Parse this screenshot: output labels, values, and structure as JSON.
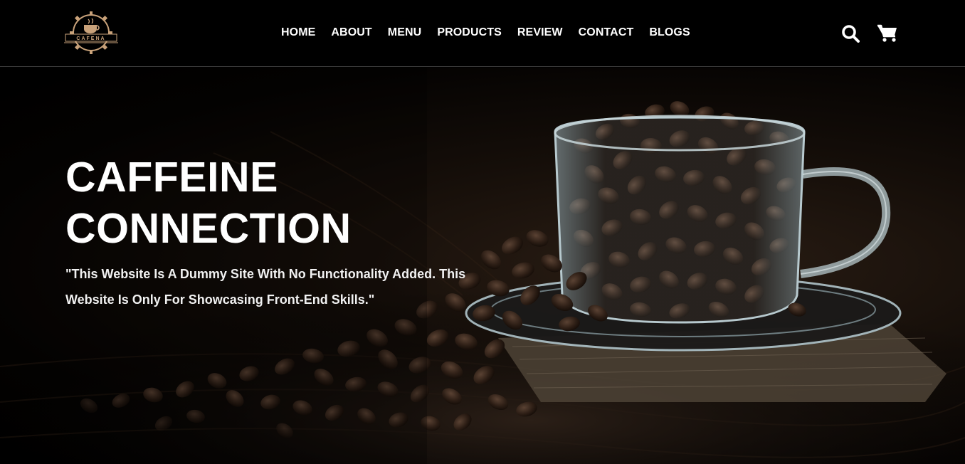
{
  "brand": {
    "logo_text": "CAFENA",
    "logo_color": "#c9a27a"
  },
  "nav": {
    "items": [
      {
        "label": "HOME"
      },
      {
        "label": "ABOUT"
      },
      {
        "label": "MENU"
      },
      {
        "label": "PRODUCTS"
      },
      {
        "label": "REVIEW"
      },
      {
        "label": "CONTACT"
      },
      {
        "label": "BLOGS"
      }
    ]
  },
  "header_icons": {
    "search": "search-icon",
    "cart": "cart-icon"
  },
  "hero": {
    "title_line1": "CAFFEINE",
    "title_line2": "CONNECTION",
    "description": "\"This Website Is A Dummy Site With No Functionality Added. This Website Is Only For Showcasing Front-End Skills.\""
  },
  "colors": {
    "background": "#000000",
    "text": "#ffffff",
    "accent": "#c9a27a"
  }
}
